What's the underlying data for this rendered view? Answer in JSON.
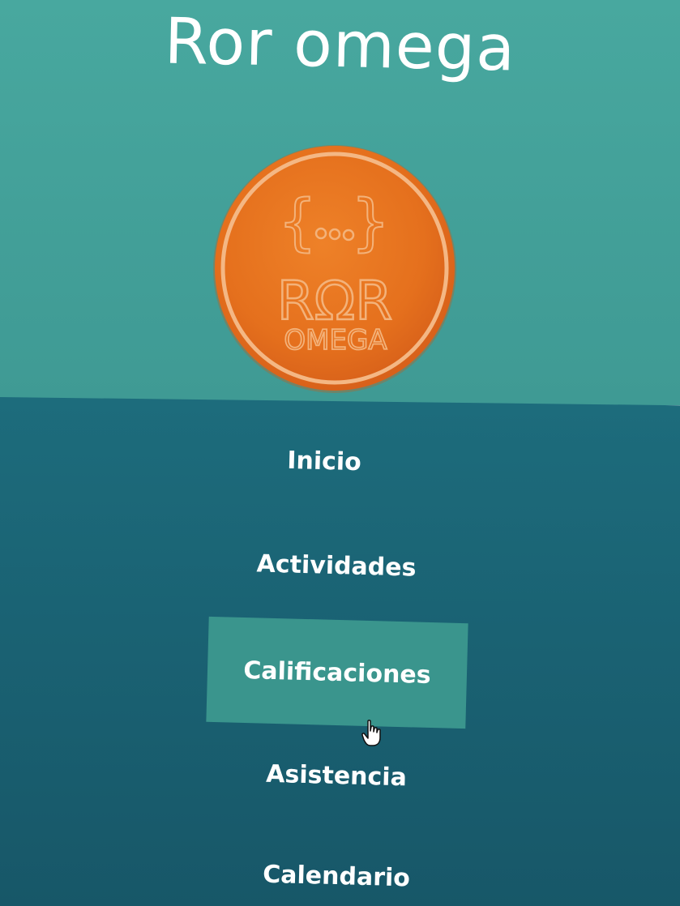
{
  "header": {
    "title": "Ror omega"
  },
  "logo": {
    "monogram": "RΩR",
    "wordmark": "OMEGA",
    "braces": "{...}"
  },
  "nav": {
    "items": [
      {
        "label": "Inicio",
        "active": false
      },
      {
        "label": "Actividades",
        "active": false
      },
      {
        "label": "Calificaciones",
        "active": true
      },
      {
        "label": "Asistencia",
        "active": false
      },
      {
        "label": "Calendario",
        "active": false
      }
    ]
  },
  "colors": {
    "header_bg": "#46a59d",
    "nav_bg": "#1a6273",
    "active_item_bg": "#3a958d",
    "logo_orange": "#e8741f",
    "text": "#ffffff"
  },
  "icons": {
    "cursor": "hand-pointer-icon"
  }
}
